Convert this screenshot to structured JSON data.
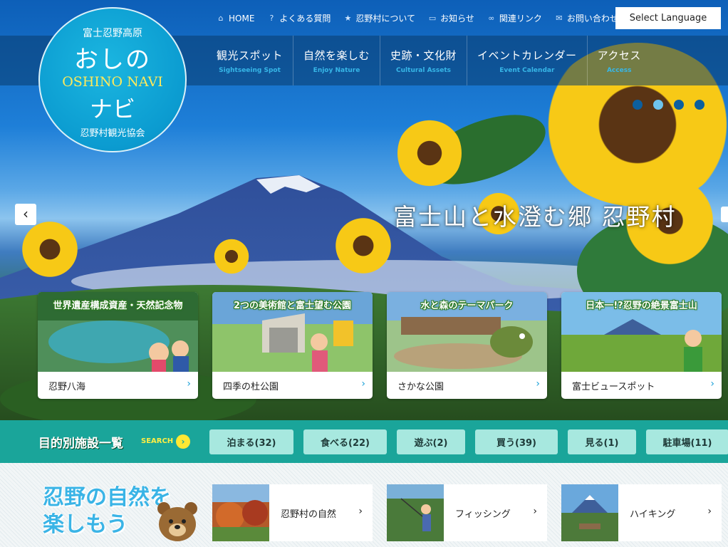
{
  "utility_nav": [
    {
      "label": "HOME",
      "icon": "home-icon",
      "glyph": "⌂"
    },
    {
      "label": "よくある質問",
      "icon": "question-icon",
      "glyph": "?"
    },
    {
      "label": "忍野村について",
      "icon": "star-icon",
      "glyph": "★"
    },
    {
      "label": "お知らせ",
      "icon": "chat-icon",
      "glyph": "▭"
    },
    {
      "label": "関連リンク",
      "icon": "link-icon",
      "glyph": "∞"
    },
    {
      "label": "お問い合わせ",
      "icon": "mail-icon",
      "glyph": "✉"
    }
  ],
  "language_button": "Select Language",
  "logo": {
    "line1": "富士忍野高原",
    "line2": "おしの",
    "line3": "OSHINO NAVI",
    "line4": "ナビ",
    "line5": "忍野村観光協会"
  },
  "main_nav": [
    {
      "jp": "観光スポット",
      "en": "Sightseeing Spot"
    },
    {
      "jp": "自然を楽しむ",
      "en": "Enjoy Nature"
    },
    {
      "jp": "史跡・文化財",
      "en": "Cultural Assets"
    },
    {
      "jp": "イベントカレンダー",
      "en": "Event Calendar"
    },
    {
      "jp": "アクセス",
      "en": "Access"
    }
  ],
  "hero": {
    "title": "富士山と水澄む郷 忍野村",
    "slides_total": 4,
    "active_slide": 2
  },
  "feature_cards": [
    {
      "tag": "世界遺産構成資産・天然記念物",
      "label": "忍野八海"
    },
    {
      "tag": "2つの美術館と富士望む公園",
      "label": "四季の杜公園"
    },
    {
      "tag": "水と森のテーマパーク",
      "label": "さかな公園"
    },
    {
      "tag": "日本一!?忍野の絶景富士山",
      "label": "富士ビュースポット"
    }
  ],
  "search": {
    "title": "目的別施設一覧",
    "keyword": "SEARCH",
    "categories": [
      {
        "label": "泊まる(32)"
      },
      {
        "label": "食べる(22)"
      },
      {
        "label": "遊ぶ(2)"
      },
      {
        "label": "買う(39)"
      },
      {
        "label": "見る(1)"
      },
      {
        "label": "駐車場(11)"
      }
    ]
  },
  "nature": {
    "title_line1": "忍野の自然を",
    "title_line2": "楽しもう",
    "items": [
      {
        "label": "忍野村の自然"
      },
      {
        "label": "フィッシング"
      },
      {
        "label": "ハイキング"
      }
    ]
  },
  "colors": {
    "accent_teal": "#1aa59a",
    "category_button": "#a7e8df",
    "logo_blue": "#0b9bd0",
    "nav_en": "#37b7e8"
  }
}
